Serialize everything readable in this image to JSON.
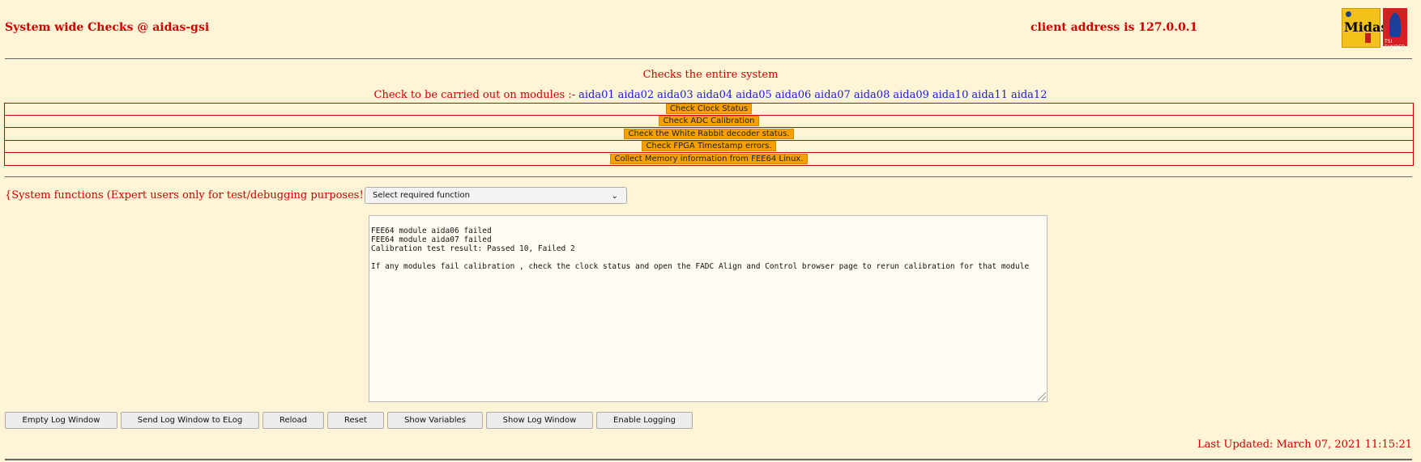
{
  "header": {
    "title": "System wide Checks @ aidas-gsi",
    "client": "client address is 127.0.0.1"
  },
  "logos": {
    "midas_text": "Midas",
    "tsi_caption": "TSI FUNDED"
  },
  "subtitle": "Checks the entire system",
  "modules": {
    "prefix": "Check to be carried out on modules :-",
    "items": [
      "aida01",
      "aida02",
      "aida03",
      "aida04",
      "aida05",
      "aida06",
      "aida07",
      "aida08",
      "aida09",
      "aida10",
      "aida11",
      "aida12"
    ]
  },
  "checks": [
    "Check Clock Status",
    "Check ADC Calibration",
    "Check the White Rabbit decoder status.",
    "Check FPGA Timestamp errors.",
    "Collect Memory information from FEE64 Linux."
  ],
  "system_functions": {
    "label": "{System functions (Expert users only for test/debugging purposes!!!)  } {",
    "select_value": "Select required function"
  },
  "log": {
    "lines": [
      "FEE64 module aida06 failed",
      "FEE64 module aida07 failed",
      "Calibration test result: Passed 10, Failed 2",
      "",
      "If any modules fail calibration , check the clock status and open the FADC Align and Control browser page to rerun calibration for that module"
    ]
  },
  "buttons": {
    "empty_log": "Empty Log Window",
    "send_elog": "Send Log Window to ELog",
    "reload": "Reload",
    "reset": "Reset",
    "show_variables": "Show Variables",
    "show_log": "Show Log Window",
    "enable_logging": "Enable Logging"
  },
  "last_updated": "Last Updated: March 07, 2021 11:15:21",
  "colors": {
    "background": "#fff5d6",
    "text_red": "#cc0000",
    "link_blue": "#1a1ad6",
    "check_orange": "#f5a000"
  }
}
